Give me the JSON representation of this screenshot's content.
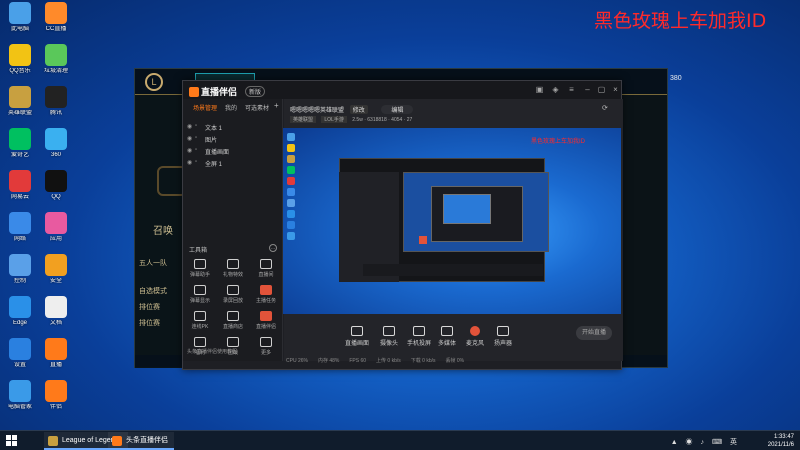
{
  "overlay": {
    "title": "黑色玫瑰上车加我ID"
  },
  "desktop": {
    "icons": [
      {
        "label": "此电脑",
        "color": "#4aa0e8"
      },
      {
        "label": "CC直播",
        "color": "#ff8a2a"
      },
      {
        "label": "QQ音乐",
        "color": "#f2c314"
      },
      {
        "label": "垃圾清理",
        "color": "#5ac85a"
      },
      {
        "label": "英雄联盟",
        "color": "#c8a040"
      },
      {
        "label": "腾讯",
        "color": "#222"
      },
      {
        "label": "爱奇艺",
        "color": "#00c060"
      },
      {
        "label": "360",
        "color": "#3ab0f0"
      },
      {
        "label": "网易云",
        "color": "#e23a3a"
      },
      {
        "label": "QQ",
        "color": "#111"
      },
      {
        "label": "网络",
        "color": "#3a8ae8"
      },
      {
        "label": "应用",
        "color": "#e85aa0"
      },
      {
        "label": "控制",
        "color": "#5aa0e8"
      },
      {
        "label": "安全",
        "color": "#f2a020"
      },
      {
        "label": "Edge",
        "color": "#2a90e8"
      },
      {
        "label": "文档",
        "color": "#eee"
      },
      {
        "label": "设置",
        "color": "#2a80e0"
      },
      {
        "label": "直播",
        "color": "#ff7a1a"
      },
      {
        "label": "电脑管家",
        "color": "#3a9ae8"
      },
      {
        "label": "伴侣",
        "color": "#ff7a1a"
      }
    ]
  },
  "lol": {
    "logo": "L",
    "side_labels": [
      "召唤",
      "五人一队",
      "自选模式",
      "排位赛",
      "排位赛"
    ],
    "rp": "380"
  },
  "app": {
    "logo_text": "直播伴侣",
    "badge": "新版",
    "tabs": [
      "场景管理",
      "我的",
      "可选素材"
    ],
    "add": "+",
    "scenes": [
      "文本 1",
      "图片",
      "直播画面",
      "全屏 1"
    ],
    "tools_header": "工具箱",
    "tools": [
      {
        "label": "弹幕助手",
        "hot": false
      },
      {
        "label": "礼物特效",
        "hot": false
      },
      {
        "label": "直播间",
        "hot": false
      },
      {
        "label": "弹幕显示",
        "hot": false
      },
      {
        "label": "录屏回放",
        "hot": false
      },
      {
        "label": "主播任务",
        "hot": true
      },
      {
        "label": "连线PK",
        "hot": false
      },
      {
        "label": "直播商店",
        "hot": false
      },
      {
        "label": "直播伴侣",
        "hot": true
      },
      {
        "label": "福利",
        "hot": false
      },
      {
        "label": "团战",
        "hot": false
      },
      {
        "label": "更多",
        "hot": false
      }
    ],
    "foot_note": "头条直播伴侣使用教程",
    "room_title": "嗯嗯嗯嗯嗯英雄联盟",
    "room_tag": "修改",
    "room_edit": "编辑",
    "room_info": [
      "英雄联盟",
      "LOL手游",
      "首页推荐",
      "超清"
    ],
    "room_stats": "2.5w · 6318818 · 4054 · 27",
    "preview_note": "黑色玫瑰上车加我ID",
    "bottom_buttons": [
      "直播画面",
      "摄像头",
      "手机投屏",
      "多媒体",
      "麦克风",
      "扬声器"
    ],
    "start_live": "开始直播",
    "status": [
      "CPU 26%",
      "内存 48%",
      "FPS 60",
      "上传 0 kb/s",
      "下载 0 kb/s",
      "丢帧 0%"
    ]
  },
  "taskbar": {
    "items": [
      "League of Legends",
      "头条直播伴侣"
    ],
    "time": "1:33:47",
    "date": "2021/11/6"
  }
}
